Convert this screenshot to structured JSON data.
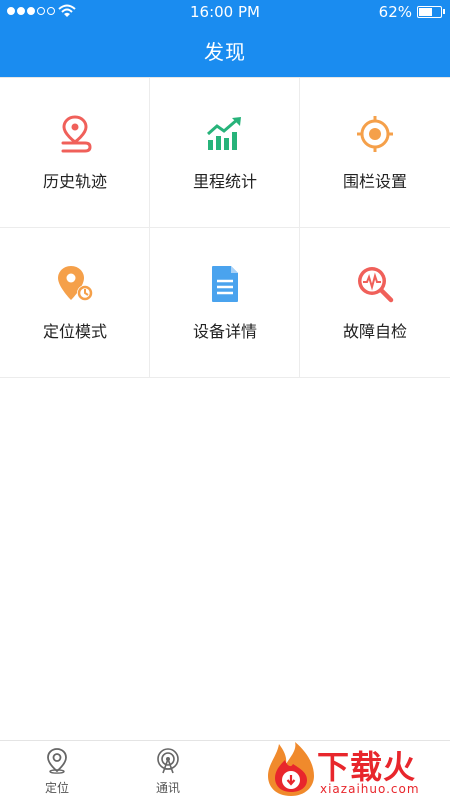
{
  "status_bar": {
    "time": "16:00 PM",
    "battery": "62%",
    "battery_level": 0.62,
    "signal_bars_filled": 3,
    "signal_bars_total": 5
  },
  "header": {
    "title": "发现"
  },
  "grid": {
    "items": [
      {
        "label": "历史轨迹",
        "icon": "location-track-icon",
        "color": "#f0605a"
      },
      {
        "label": "里程统计",
        "icon": "bar-chart-trend-icon",
        "color": "#27b37a"
      },
      {
        "label": "围栏设置",
        "icon": "target-icon",
        "color": "#f5a04a"
      },
      {
        "label": "定位模式",
        "icon": "location-mode-icon",
        "color": "#f5a04a"
      },
      {
        "label": "设备详情",
        "icon": "document-icon",
        "color": "#4aa3ee"
      },
      {
        "label": "故障自检",
        "icon": "diagnostic-search-icon",
        "color": "#f0605a"
      }
    ]
  },
  "tabbar": {
    "tabs": [
      {
        "label": "定位",
        "icon": "location-pin-icon"
      },
      {
        "label": "通讯",
        "icon": "antenna-icon"
      }
    ]
  },
  "watermark": {
    "text": "下载火",
    "sub": "xiazaihuo.com"
  },
  "colors": {
    "header": "#1a8cf0",
    "brand_red": "#e8262c"
  }
}
